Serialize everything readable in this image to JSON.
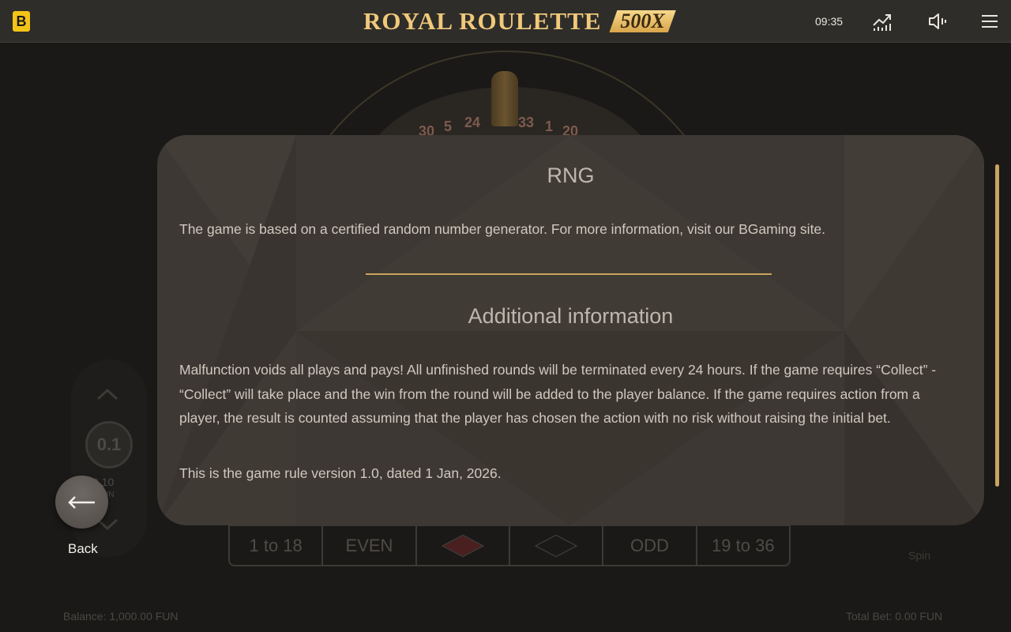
{
  "header": {
    "brand_letter": "B",
    "title": "ROYAL ROULETTE",
    "title_badge": "500X",
    "clock": "09:35",
    "icons": [
      "stats-icon",
      "sound-icon",
      "menu-icon"
    ]
  },
  "game": {
    "wheel_numbers": [
      "30",
      "5",
      "24",
      "33",
      "1",
      "20"
    ],
    "bet_row": [
      "1 to 18",
      "EVEN",
      "",
      "",
      "ODD",
      "19 to 36"
    ],
    "chip_value": "0.1",
    "chip_sub": "0.10",
    "chip_unit": "FUN",
    "spin_label": "Spin",
    "balance": "Balance: 1,000.00 FUN",
    "total_bet": "Total Bet: 0.00 FUN"
  },
  "rules": {
    "rng_title": "RNG",
    "rng_text": "The game is based on a certified random number generator. For more information, visit our BGaming site.",
    "additional_title": "Additional information",
    "additional_text": "Malfunction voids all plays and pays! All unfinished rounds will be terminated every 24 hours. If the game requires “Collect” - “Collect” will take place and the win from the round will be added to the player balance. If the game requires action from a player, the result is counted assuming that the player has chosen the action with no risk without raising the initial bet.",
    "version_text": "This is the game rule version 1.0, dated 1 Jan, 2026."
  },
  "back": {
    "label": "Back"
  },
  "colors": {
    "accent_gold": "#c9a45f",
    "brand_yellow": "#f2c417",
    "modal_bg": "#3d3833"
  }
}
